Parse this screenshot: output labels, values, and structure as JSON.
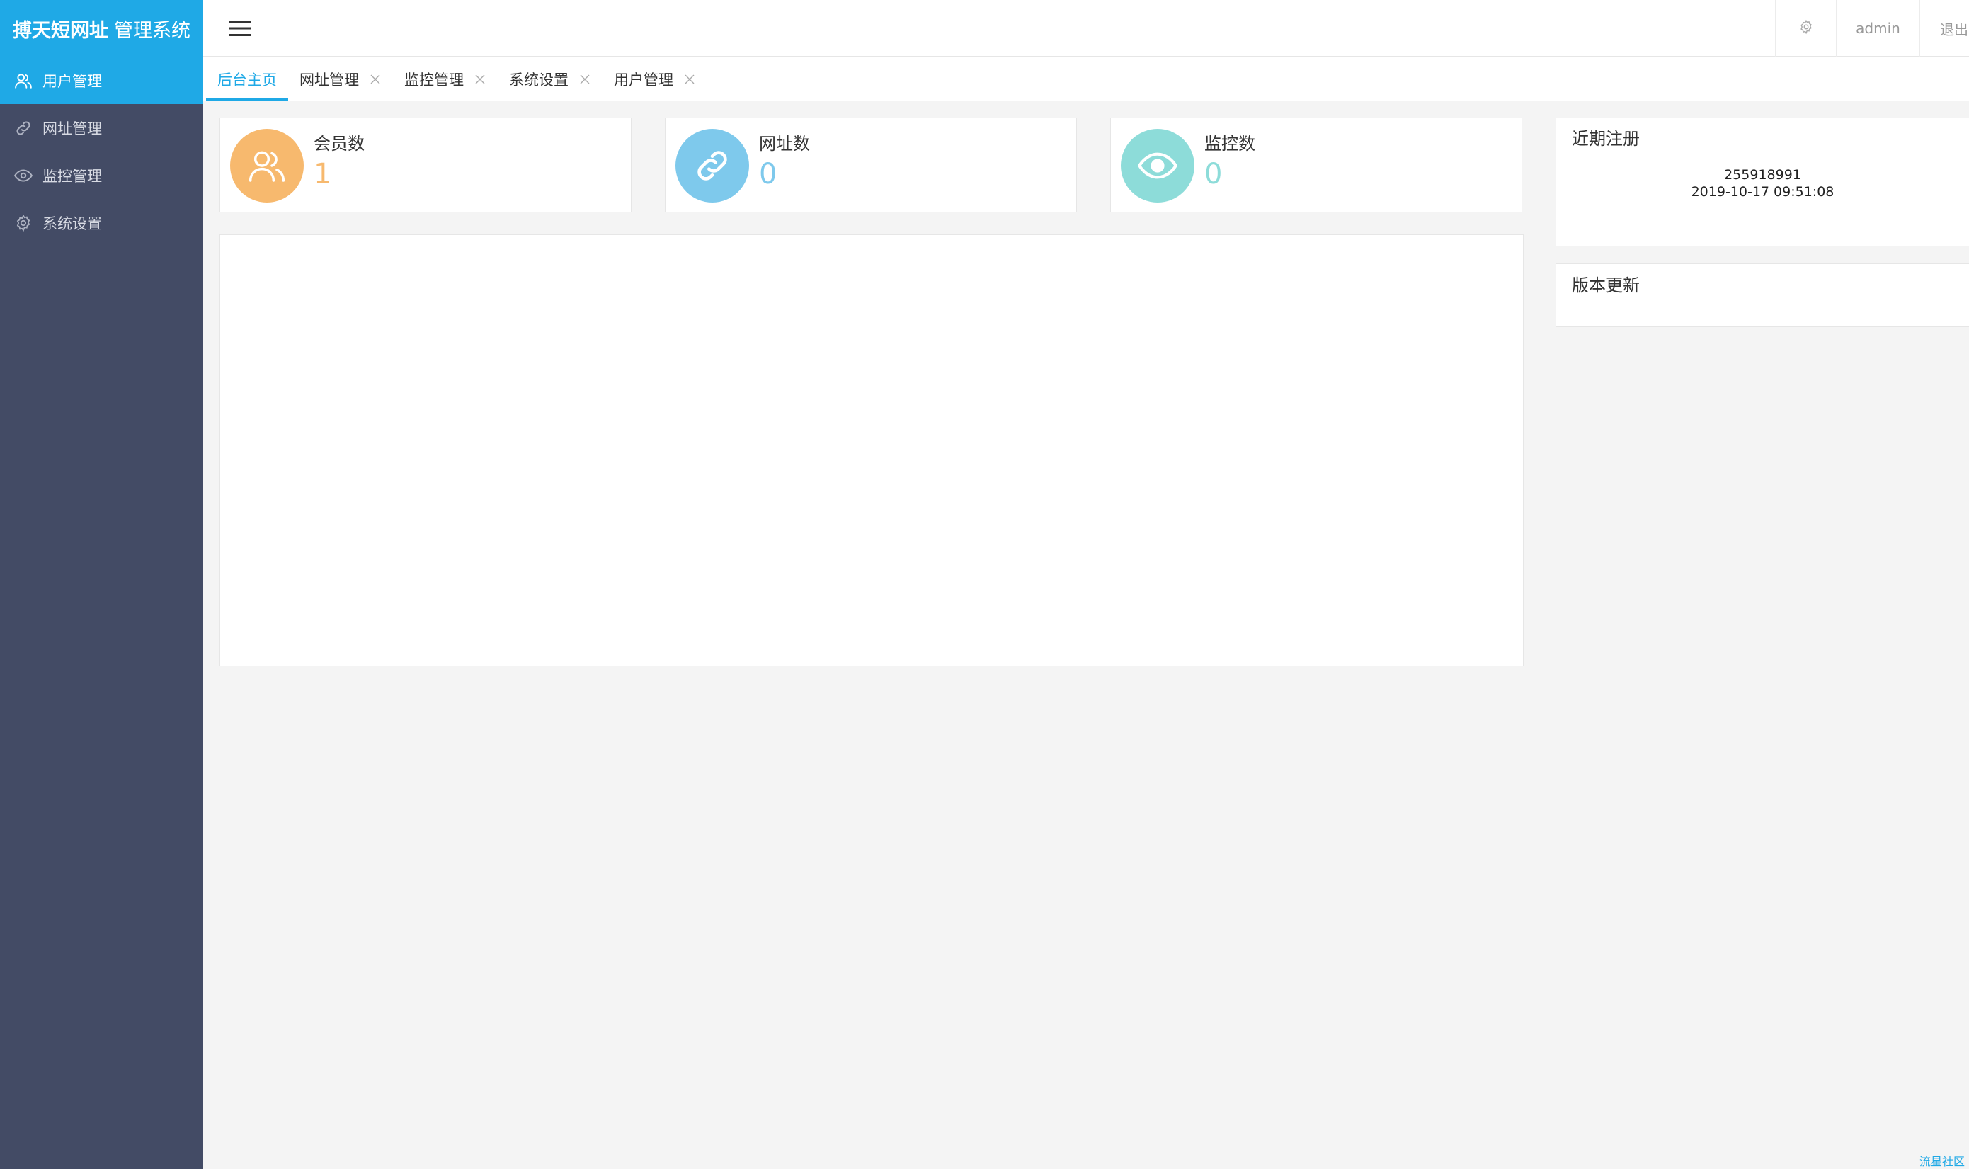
{
  "app": {
    "brand": "搏天短网址",
    "suffix": "管理系统"
  },
  "sidebar": {
    "items": [
      {
        "label": "用户管理",
        "icon": "users-icon",
        "active": true
      },
      {
        "label": "网址管理",
        "icon": "link-icon",
        "active": false
      },
      {
        "label": "监控管理",
        "icon": "eye-icon",
        "active": false
      },
      {
        "label": "系统设置",
        "icon": "gear-icon",
        "active": false
      }
    ]
  },
  "header": {
    "menu_icon": "hamburger-icon",
    "settings_icon": "gear-icon",
    "user": "admin",
    "logout": "退出"
  },
  "tabs": [
    {
      "label": "后台主页",
      "active": true,
      "closable": false
    },
    {
      "label": "网址管理",
      "active": false,
      "closable": true
    },
    {
      "label": "监控管理",
      "active": false,
      "closable": true
    },
    {
      "label": "系统设置",
      "active": false,
      "closable": true
    },
    {
      "label": "用户管理",
      "active": false,
      "closable": true
    }
  ],
  "stats": [
    {
      "label": "会员数",
      "value": "1",
      "icon": "users-icon",
      "color": "#f7b96e",
      "value_color": "#f7b96e"
    },
    {
      "label": "网址数",
      "value": "0",
      "icon": "link-icon",
      "color": "#7ec9ec",
      "value_color": "#7ec9ec"
    },
    {
      "label": "监控数",
      "value": "0",
      "icon": "eye-icon",
      "color": "#8ddcd9",
      "value_color": "#8ddcd9"
    }
  ],
  "recent": {
    "title": "近期注册",
    "entries": [
      {
        "user": "255918991",
        "time": "2019-10-17 09:51:08"
      }
    ]
  },
  "updates": {
    "title": "版本更新"
  },
  "footer": {
    "link": "流星社区"
  },
  "colors": {
    "accent": "#1fa9e6",
    "sidebar": "#434b65",
    "background": "#f4f4f4"
  }
}
